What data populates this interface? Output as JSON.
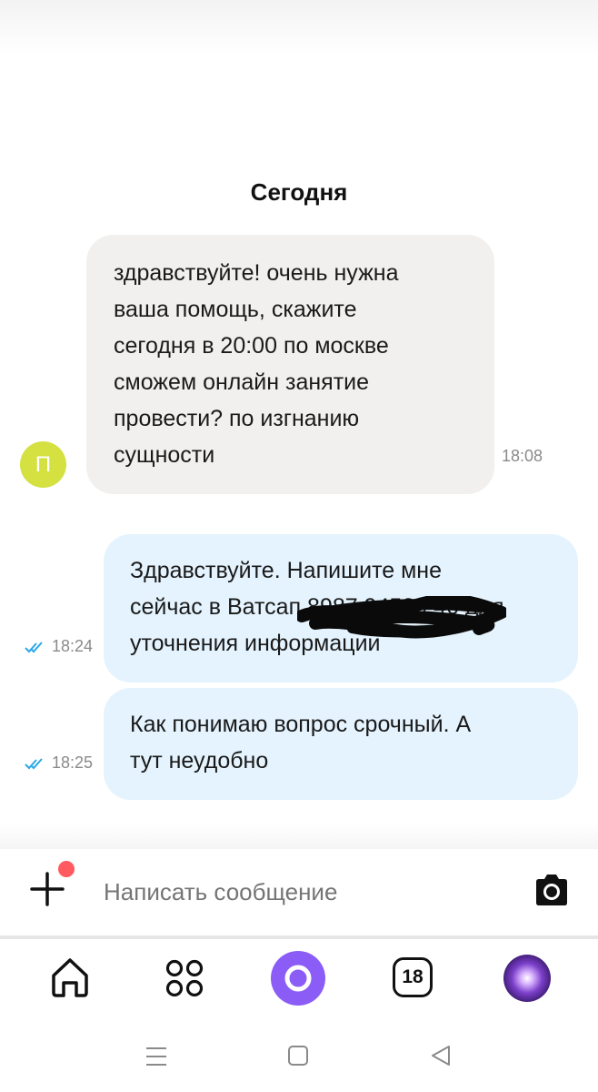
{
  "chat": {
    "date_separator": "Сегодня",
    "incoming": {
      "avatar_letter": "П",
      "avatar_color": "#d4e141",
      "lines": [
        "здравствуйте! очень нужна",
        "ваша помощь, скажите",
        "сегодня в 20:00 по москве",
        "сможем онлайн занятие",
        "провести? по изгнанию",
        "сущности"
      ],
      "time": "18:08"
    },
    "outgoing": [
      {
        "lines": [
          "Здравствуйте. Напишите мне",
          "сейчас в Ватсап 8987 94539 46 для",
          "уточнения информации"
        ],
        "time": "18:24",
        "status": "read"
      },
      {
        "lines": [
          "Как понимаю вопрос срочный. А",
          "тут неудобно"
        ],
        "time": "18:25",
        "status": "read"
      }
    ]
  },
  "composer": {
    "placeholder": "Написать сообщение",
    "attach_icon": "plus-icon",
    "camera_icon": "camera-icon"
  },
  "bottom_nav": {
    "items": [
      "home-icon",
      "services-grid-icon",
      "alice-assistant-icon",
      "calendar-icon",
      "profile-avatar"
    ],
    "calendar_day": "18",
    "accent_color": "#8b5cf6"
  },
  "system_nav": [
    "menu-icon",
    "home-square-icon",
    "back-triangle-icon"
  ]
}
